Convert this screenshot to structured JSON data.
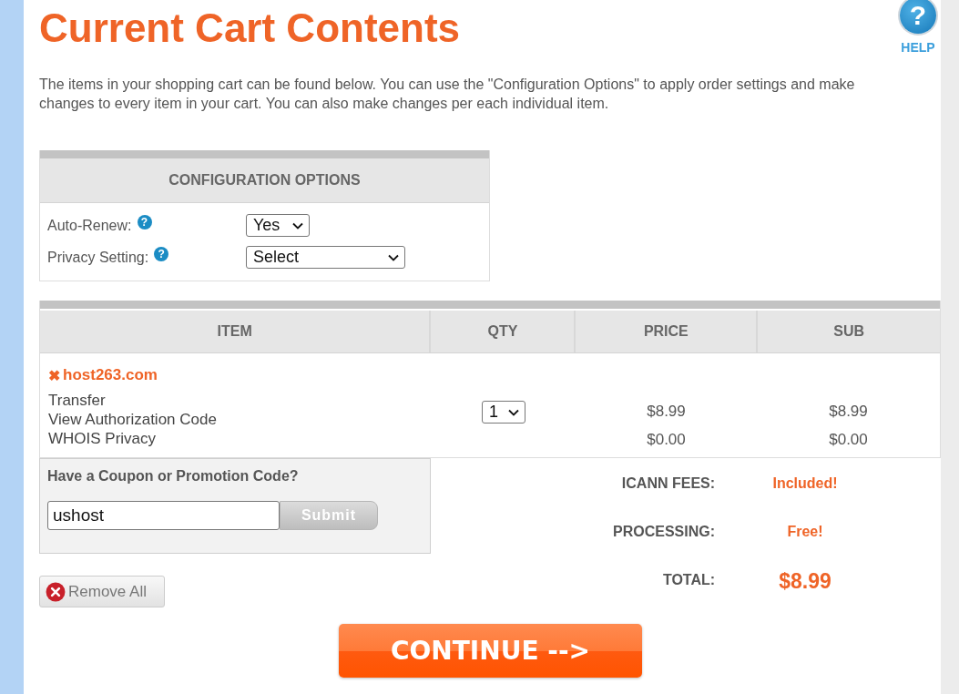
{
  "page": {
    "title": "Current Cart Contents",
    "intro": "The items in your shopping cart can be found below. You can use the \"Configuration Options\" to apply order settings and make changes to every item in your cart. You can also make changes per each individual item."
  },
  "help": {
    "glyph": "?",
    "label": "HELP"
  },
  "config": {
    "title": "CONFIGURATION OPTIONS",
    "options": [
      {
        "label": "Auto-Renew:",
        "info_glyph": "?",
        "value": "Yes",
        "kind": "short"
      },
      {
        "label": "Privacy Setting:",
        "info_glyph": "?",
        "value": "Select",
        "kind": "wide"
      }
    ]
  },
  "cart": {
    "columns": [
      "ITEM",
      "QTY",
      "PRICE",
      "SUB"
    ],
    "items": [
      {
        "remove_glyph": "✖",
        "domain": "host263.com",
        "lines": [
          "Transfer",
          "View Authorization Code",
          "WHOIS Privacy"
        ],
        "qty": "1",
        "charges": [
          {
            "price": "$8.99",
            "sub": "$8.99"
          },
          {
            "price": "$0.00",
            "sub": "$0.00"
          }
        ]
      }
    ]
  },
  "coupon": {
    "title": "Have a Coupon or Promotion Code?",
    "value": "ushost",
    "button": "Submit"
  },
  "totals": [
    {
      "label": "ICANN FEES:",
      "value": "Included!",
      "kind": "fee"
    },
    {
      "label": "PROCESSING:",
      "value": "Free!",
      "kind": "fee"
    },
    {
      "label": "TOTAL:",
      "value": "$8.99",
      "kind": "total"
    }
  ],
  "actions": {
    "remove_all": "Remove All",
    "continue": "CONTINUE -->"
  }
}
